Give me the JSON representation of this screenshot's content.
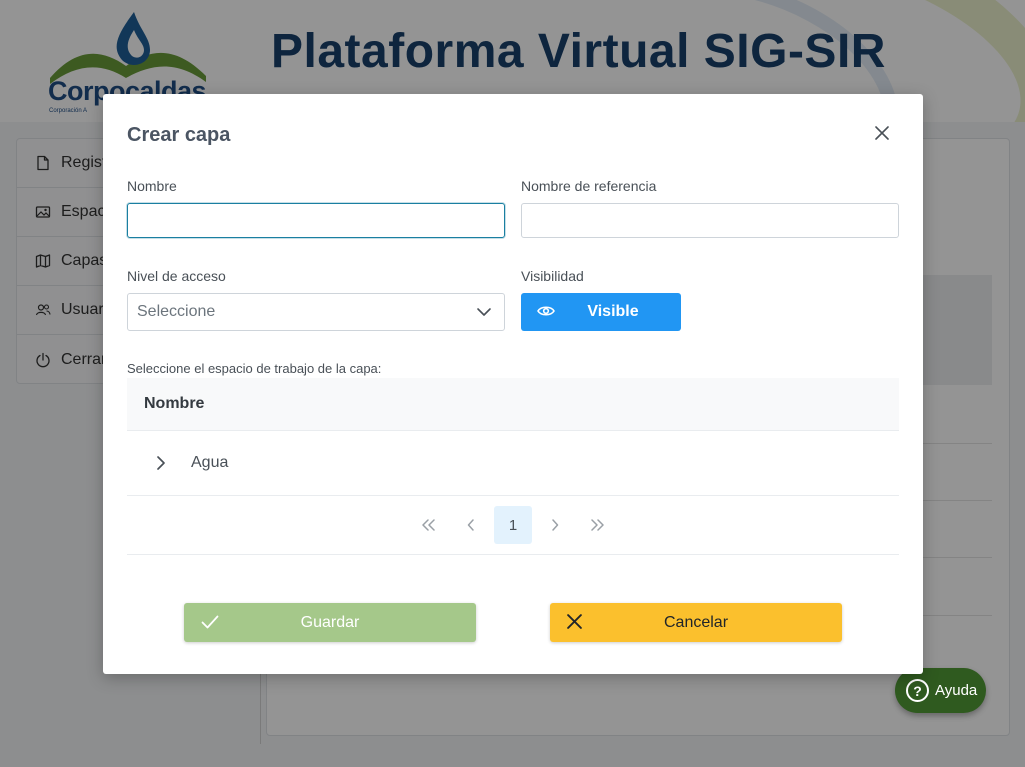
{
  "header": {
    "logo_name": "Corpocaldas",
    "logo_subtitle": "Corporación A",
    "title": "Plataforma Virtual SIG-SIR"
  },
  "sidebar": {
    "items": [
      {
        "label": "Regist",
        "icon": "file-icon"
      },
      {
        "label": "Espac",
        "icon": "image-icon"
      },
      {
        "label": "Capas",
        "icon": "map-icon"
      },
      {
        "label": "Usuar",
        "icon": "users-icon"
      },
      {
        "label": "Cerrar",
        "icon": "power-icon"
      }
    ]
  },
  "help_button": {
    "label": "Ayuda"
  },
  "modal": {
    "title": "Crear capa",
    "name_field": {
      "label": "Nombre",
      "value": "",
      "placeholder": ""
    },
    "reference_field": {
      "label": "Nombre de referencia",
      "value": "",
      "placeholder": ""
    },
    "access_level": {
      "label": "Nivel de acceso",
      "selected": "Seleccione"
    },
    "visibility": {
      "label": "Visibilidad",
      "button_label": "Visible"
    },
    "workspace_label": "Seleccione el espacio de trabajo de la capa:",
    "table": {
      "header": "Nombre",
      "rows": [
        {
          "name": "Agua"
        }
      ]
    },
    "paginator": {
      "first": "«",
      "prev": "‹",
      "current_page": "1",
      "next": "›",
      "last": "»"
    },
    "save_label": "Guardar",
    "cancel_label": "Cancelar"
  },
  "colors": {
    "primary": "#2196f3",
    "save": "#a5c88a",
    "cancel": "#fbc02d",
    "title": "#19416b",
    "help": "#2f5a1f"
  }
}
